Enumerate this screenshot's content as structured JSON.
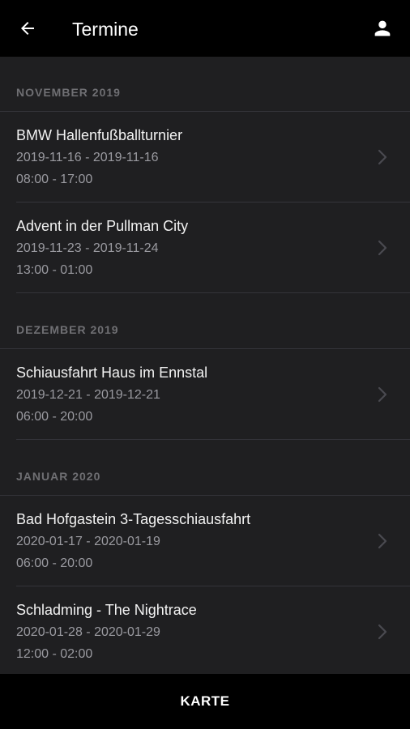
{
  "appbar": {
    "title": "Termine",
    "back_icon": "arrow-left-icon",
    "profile_icon": "person-icon"
  },
  "sections": [
    {
      "header": "NOVEMBER 2019",
      "items": [
        {
          "title": "BMW Hallenfußballturnier",
          "dates": "2019-11-16 - 2019-11-16",
          "times": "08:00 - 17:00"
        },
        {
          "title": "Advent in der Pullman City",
          "dates": "2019-11-23 - 2019-11-24",
          "times": "13:00 - 01:00"
        }
      ]
    },
    {
      "header": "DEZEMBER 2019",
      "items": [
        {
          "title": "Schiausfahrt Haus im Ennstal",
          "dates": "2019-12-21 - 2019-12-21",
          "times": "06:00 - 20:00"
        }
      ]
    },
    {
      "header": "JANUAR 2020",
      "items": [
        {
          "title": "Bad Hofgastein 3-Tagesschiausfahrt",
          "dates": "2020-01-17 - 2020-01-19",
          "times": "06:00 - 20:00"
        },
        {
          "title": "Schladming - The Nightrace",
          "dates": "2020-01-28 - 2020-01-29",
          "times": "12:00 - 02:00"
        }
      ]
    }
  ],
  "bottom": {
    "label": "KARTE"
  },
  "colors": {
    "appbar_bg": "#000000",
    "content_bg": "#1f1f21",
    "section_header": "#6f6f73",
    "secondary_text": "#9a9aa0",
    "divider": "#34343a",
    "chevron": "#4a4a50"
  }
}
